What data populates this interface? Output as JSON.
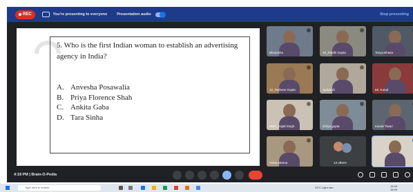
{
  "topbar": {
    "rec_label": "REC",
    "presenting_text": "You're presenting to everyone",
    "audio_text": "Presentation audio",
    "stop_label": "Stop presenting"
  },
  "slide": {
    "question": "5. Who is the first Indian woman to establish an advertising agency in India?",
    "options": [
      {
        "key": "A.",
        "text": "Anvesha Posawalia"
      },
      {
        "key": "B.",
        "text": "Priya Florence Shah"
      },
      {
        "key": "C.",
        "text": "Ankita Gaba"
      },
      {
        "key": "D.",
        "text": "Tara Sinha"
      }
    ]
  },
  "participants": [
    {
      "name": "Bhoomika"
    },
    {
      "name": "30_Riddhi Gupta"
    },
    {
      "name": "Tanya Bhasa"
    },
    {
      "name": "32_Tashvee Gupta"
    },
    {
      "name": "Jyotansh"
    },
    {
      "name": "Mr. Kunal"
    },
    {
      "name": "2007_Anjali Singh"
    },
    {
      "name": "shriya gupta"
    },
    {
      "name": "Kanak Tiwari"
    },
    {
      "name": "Vinita Meena"
    },
    {
      "name": "13 others"
    },
    {
      "name": ""
    }
  ],
  "bottombar": {
    "time_title": "4:18 PM | Brain-O-Pedia"
  },
  "taskbar": {
    "search_placeholder": "Type here to search",
    "weather": "33°C Light rain",
    "time": "16:18",
    "date": "18-09"
  },
  "colors": {
    "topbar_bg": "#1e3a8a",
    "screen_bg": "#202124",
    "rec_red": "#d93025",
    "accent_blue": "#8ab4f8",
    "end_call_red": "#ea4335"
  }
}
